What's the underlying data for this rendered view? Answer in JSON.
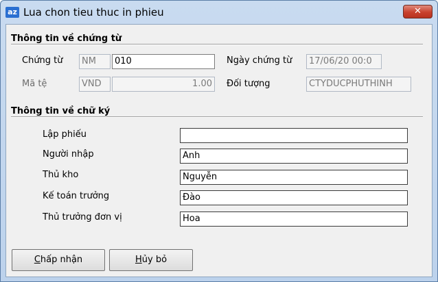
{
  "window": {
    "icon_text": "az",
    "title": "Lua chon tieu thuc in phieu",
    "close_glyph": "✕"
  },
  "document_section": {
    "title": "Thông tin về chứng từ",
    "chung_tu_label": "Chứng từ",
    "chung_tu_code": "NM",
    "chung_tu_number": "010",
    "ngay_chung_tu_label": "Ngày chứng từ",
    "ngay_chung_tu_value": "17/06/20 00:0",
    "ma_te_label": "Mã tệ",
    "ma_te_value": "VND",
    "exchange_rate": "1.00",
    "doi_tuong_label": "Đối tượng",
    "doi_tuong_value": "CTYDUCPHUTHINH"
  },
  "signature_section": {
    "title": "Thông tin về chữ ký",
    "rows": [
      {
        "label": "Lập phiếu",
        "value": ""
      },
      {
        "label": "Người nhập",
        "value": "Anh"
      },
      {
        "label": "Thủ kho",
        "value": "Nguyễn"
      },
      {
        "label": "Kế toán trưởng",
        "value": "Đào"
      },
      {
        "label": "Thủ trưởng đơn vị",
        "value": "Hoa"
      }
    ]
  },
  "buttons": {
    "accept_mnemonic": "C",
    "accept_rest": "hấp nhận",
    "cancel_mnemonic": "H",
    "cancel_rest": "ủy bỏ"
  }
}
